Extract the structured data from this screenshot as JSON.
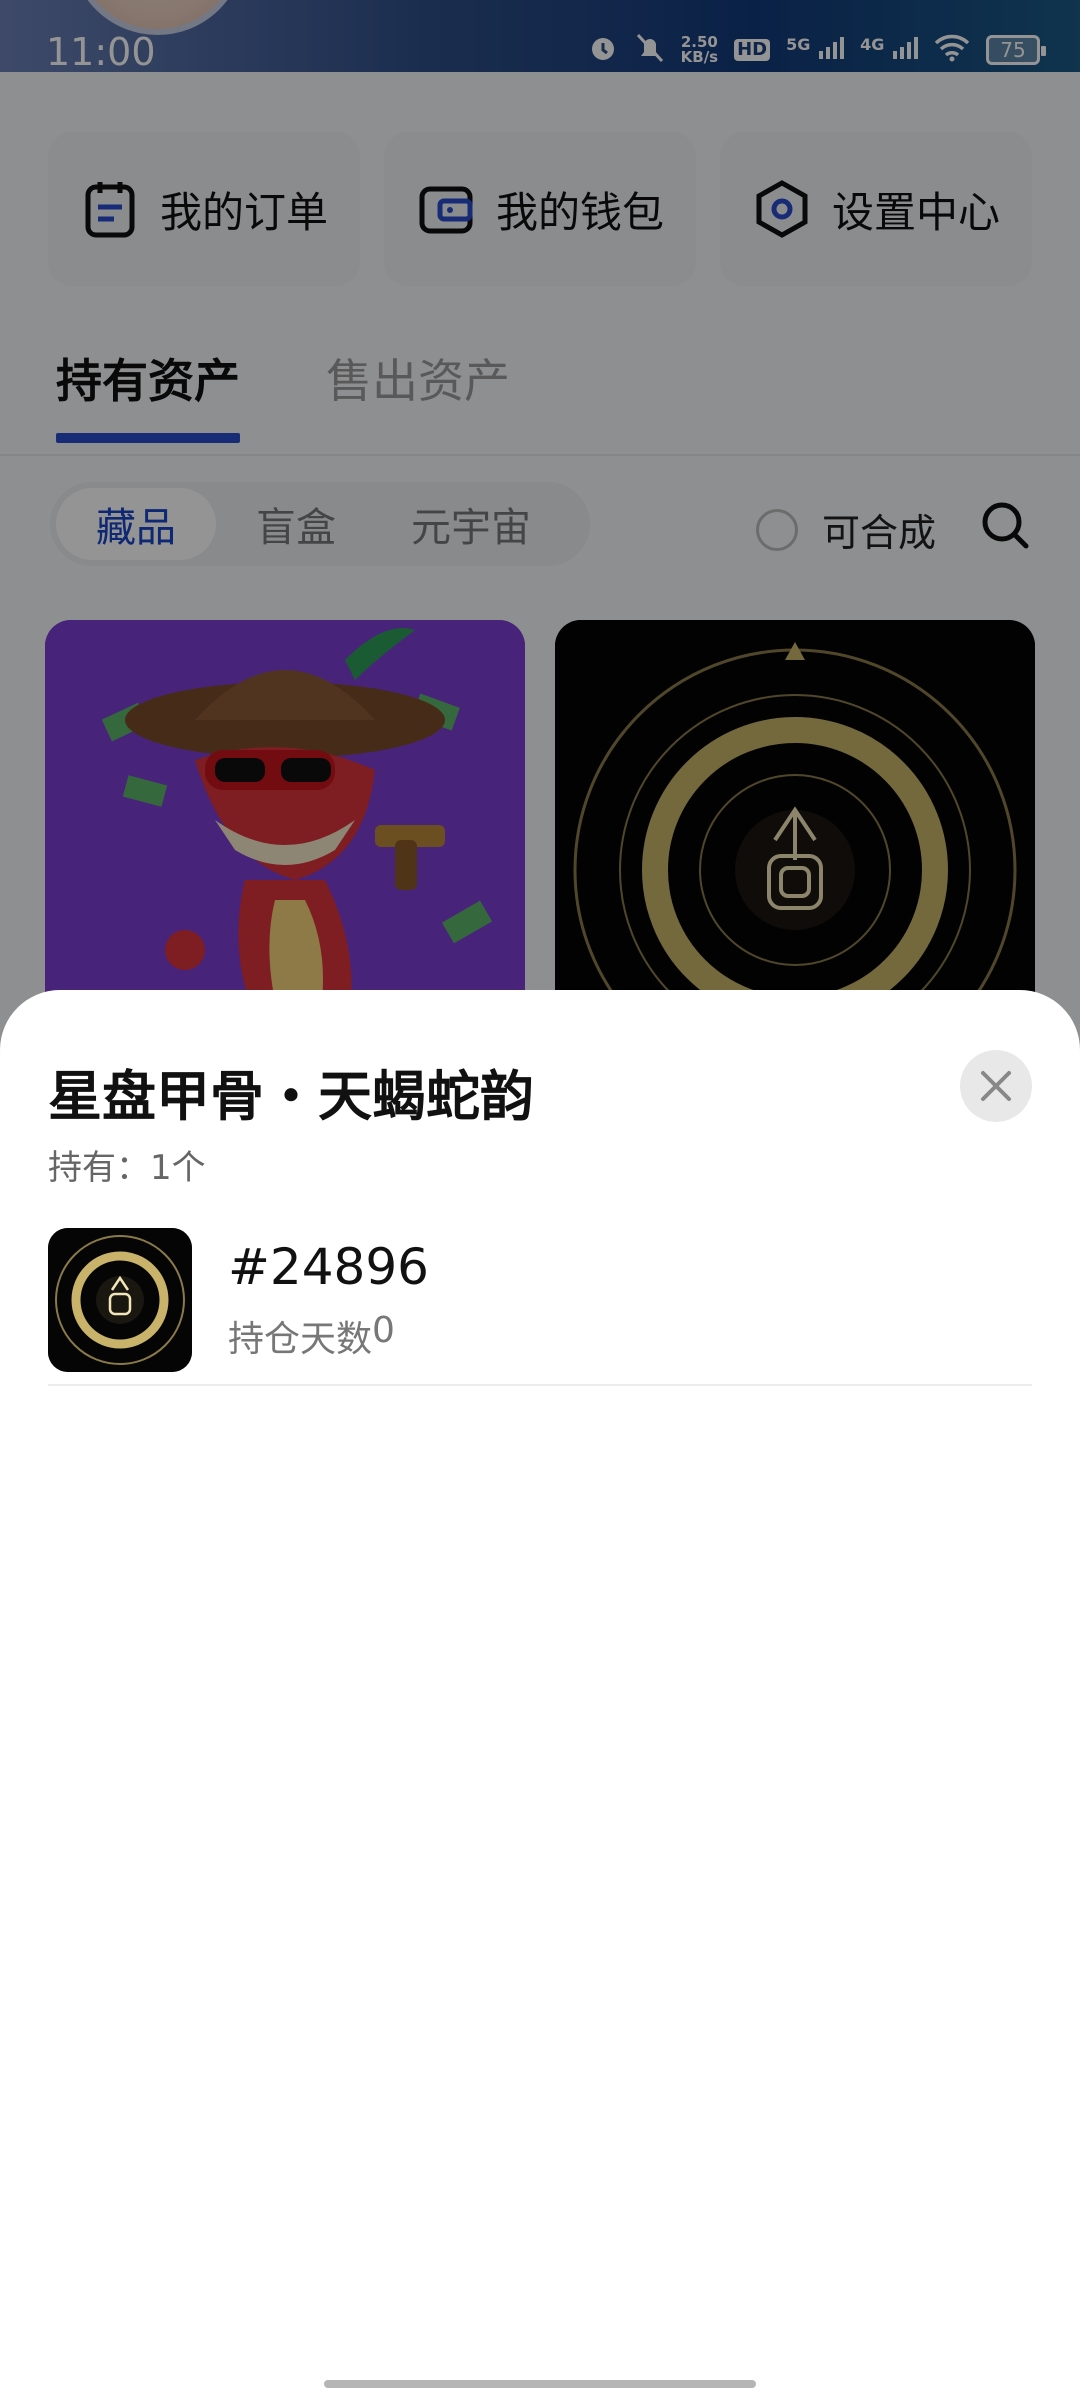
{
  "status_bar": {
    "time": "11:00",
    "net_speed_value": "2.50",
    "net_speed_unit": "KB/s",
    "hd": "HD",
    "sig1": "5G",
    "sig2": "4G",
    "battery": "75"
  },
  "shortcuts": [
    {
      "label": "我的订单",
      "icon": "order-icon"
    },
    {
      "label": "我的钱包",
      "icon": "wallet-icon"
    },
    {
      "label": "设置中心",
      "icon": "settings-icon"
    }
  ],
  "tabs": [
    {
      "label": "持有资产",
      "active": true
    },
    {
      "label": "售出资产",
      "active": false
    }
  ],
  "segments": [
    {
      "label": "藏品",
      "active": true
    },
    {
      "label": "盲盒",
      "active": false
    },
    {
      "label": "元宇宙",
      "active": false
    }
  ],
  "compose_label": "可合成",
  "sheet": {
    "title": "星盘甲骨・天蝎蛇韵",
    "held_label": "持有：",
    "held_count": "1个",
    "item": {
      "number": "#24896",
      "days_label": "持仓天数",
      "days_value": "0"
    }
  },
  "colors": {
    "accent": "#2a4bcc",
    "segment_active_text": "#1b46c7",
    "overlay": "rgba(0,0,0,0.42)"
  }
}
